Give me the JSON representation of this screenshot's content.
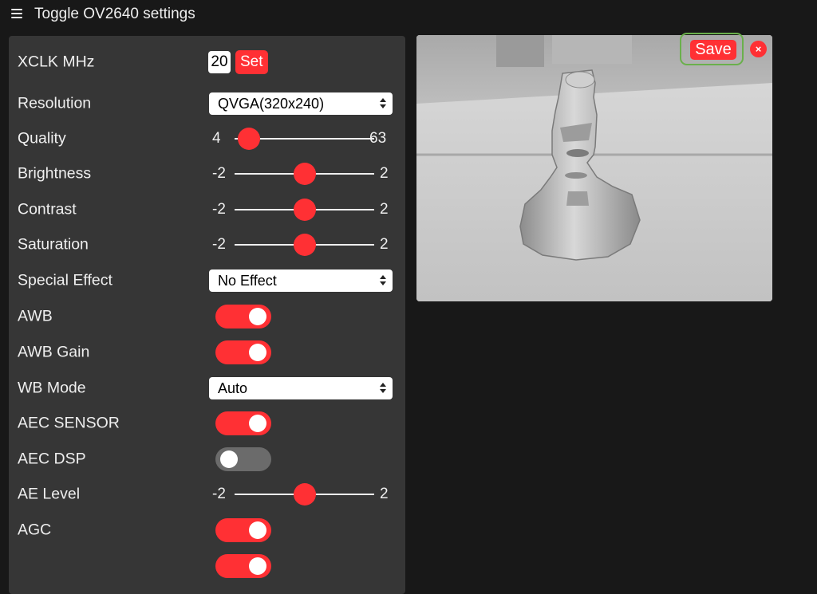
{
  "header": {
    "title": "Toggle OV2640 settings",
    "menu_icon": "hamburger-menu-icon"
  },
  "xclk": {
    "label": "XCLK MHz",
    "value": "20",
    "set_label": "Set"
  },
  "resolution": {
    "label": "Resolution",
    "value": "QVGA(320x240)"
  },
  "quality": {
    "label": "Quality",
    "min": "4",
    "max": "63",
    "value": 10
  },
  "brightness": {
    "label": "Brightness",
    "min": "-2",
    "max": "2",
    "value": 0
  },
  "contrast": {
    "label": "Contrast",
    "min": "-2",
    "max": "2",
    "value": 0
  },
  "saturation": {
    "label": "Saturation",
    "min": "-2",
    "max": "2",
    "value": 0
  },
  "special_effect": {
    "label": "Special Effect",
    "value": "No Effect"
  },
  "awb": {
    "label": "AWB",
    "on": true
  },
  "awb_gain": {
    "label": "AWB Gain",
    "on": true
  },
  "wb_mode": {
    "label": "WB Mode",
    "value": "Auto"
  },
  "aec_sensor": {
    "label": "AEC SENSOR",
    "on": true
  },
  "aec_dsp": {
    "label": "AEC DSP",
    "on": false
  },
  "ae_level": {
    "label": "AE Level",
    "min": "-2",
    "max": "2",
    "value": 0
  },
  "agc": {
    "label": "AGC",
    "on": true
  },
  "preview": {
    "save_label": "Save",
    "close_symbol": "×",
    "description": "grayscale camera frame of a small Moai statue on a table"
  },
  "colors": {
    "accent": "#ff3034",
    "panel": "#363636",
    "background": "#181818",
    "focus": "#6ab04c"
  }
}
